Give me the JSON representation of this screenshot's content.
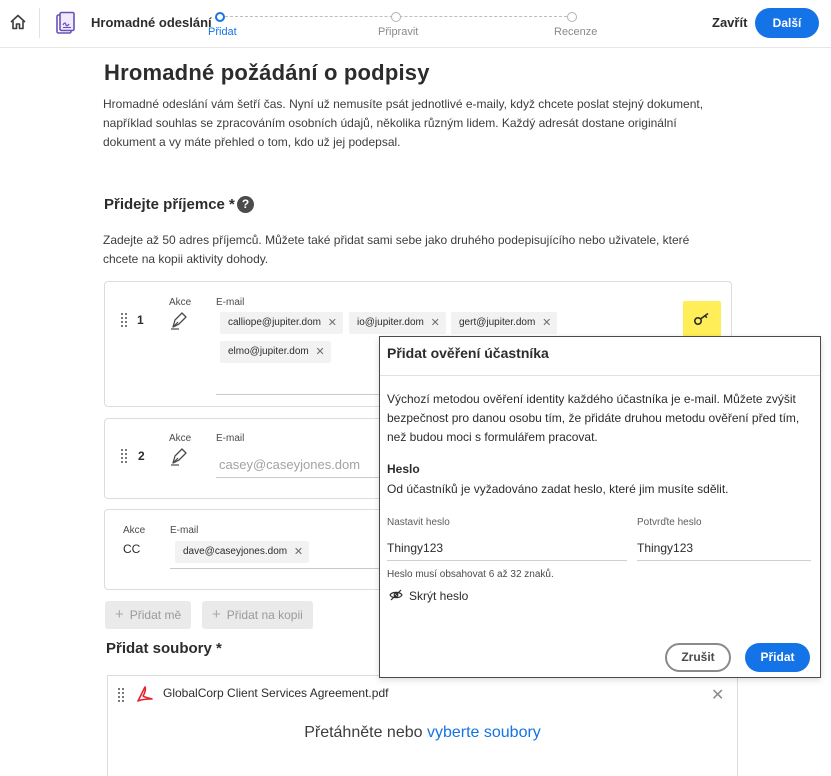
{
  "header": {
    "app_title": "Hromadné odeslání",
    "steps": [
      {
        "label": "Přidat",
        "state": "active"
      },
      {
        "label": "Připravit",
        "state": "idle"
      },
      {
        "label": "Recenze",
        "state": "idle"
      }
    ],
    "close_label": "Zavřít",
    "next_label": "Další",
    "accent_color": "#1473e6"
  },
  "main": {
    "title": "Hromadné požádání o podpisy",
    "intro": "Hromadné odeslání vám šetří čas. Nyní už nemusíte psát jednotlivé e-maily, když chcete poslat stejný dokument, například souhlas se zpracováním osobních údajů, několika různým lidem. Každý adresát dostane originální dokument a vy máte přehled o tom, kdo už jej podepsal.",
    "recipients_title": "Přidejte příjemce *",
    "help_icon": "?",
    "recipients_hint": "Zadejte až 50 adres příjemců. Můžete také přidat sami sebe jako druhého podepisujícího nebo uživatele, které chcete na kopii aktivity dohody.",
    "recipients": [
      {
        "number": "1",
        "action_label": "Akce",
        "email_label": "E-mail",
        "emails": [
          "calliope@jupiter.dom",
          "io@jupiter.dom",
          "gert@jupiter.dom",
          "elmo@jupiter.dom"
        ]
      },
      {
        "number": "2",
        "action_label": "Akce",
        "email_label": "E-mail",
        "email_placeholder": "casey@caseyjones.dom"
      },
      {
        "action_label": "Akce",
        "action_value": "CC",
        "email_label": "E-mail",
        "emails": [
          "dave@caseyjones.dom"
        ]
      }
    ],
    "add_me_label": "Přidat mě",
    "add_cc_label": "Přidat na kopii",
    "files_title": "Přidat soubory *",
    "file_name": "GlobalCorp Client Services Agreement.pdf",
    "drop_text": "Přetáhněte nebo",
    "drop_link": "vyberte soubory"
  },
  "dialog": {
    "title": "Přidat ověření účastníka",
    "description": "Výchozí metodou ověření identity každého účastníka je e-mail. Můžete zvýšit bezpečnost pro danou osobu tím, že přidáte druhou metodu ověření před tím, než budou moci s formulářem pracovat.",
    "method_title": "Heslo",
    "method_note": "Od účastníků je vyžadováno zadat heslo, které jim musíte sdělit.",
    "set_password_label": "Nastavit heslo",
    "set_password_value": "Thingy123",
    "confirm_password_label": "Potvrďte heslo",
    "confirm_password_value": "Thingy123",
    "rule": "Heslo musí obsahovat 6 až 32 znaků.",
    "hide_password_label": "Skrýt heslo",
    "cancel_label": "Zrušit",
    "add_label": "Přidat"
  },
  "icons": {
    "home": "home-icon",
    "document": "document-icon",
    "pen": "pen-icon",
    "key": "key-icon",
    "pdf": "pdf-icon",
    "eye_off": "eye-off-icon",
    "remove": "close-icon"
  },
  "colors": {
    "accent": "#1473e6",
    "key_highlight": "#ffee58",
    "pdf_red": "#e5262f"
  }
}
